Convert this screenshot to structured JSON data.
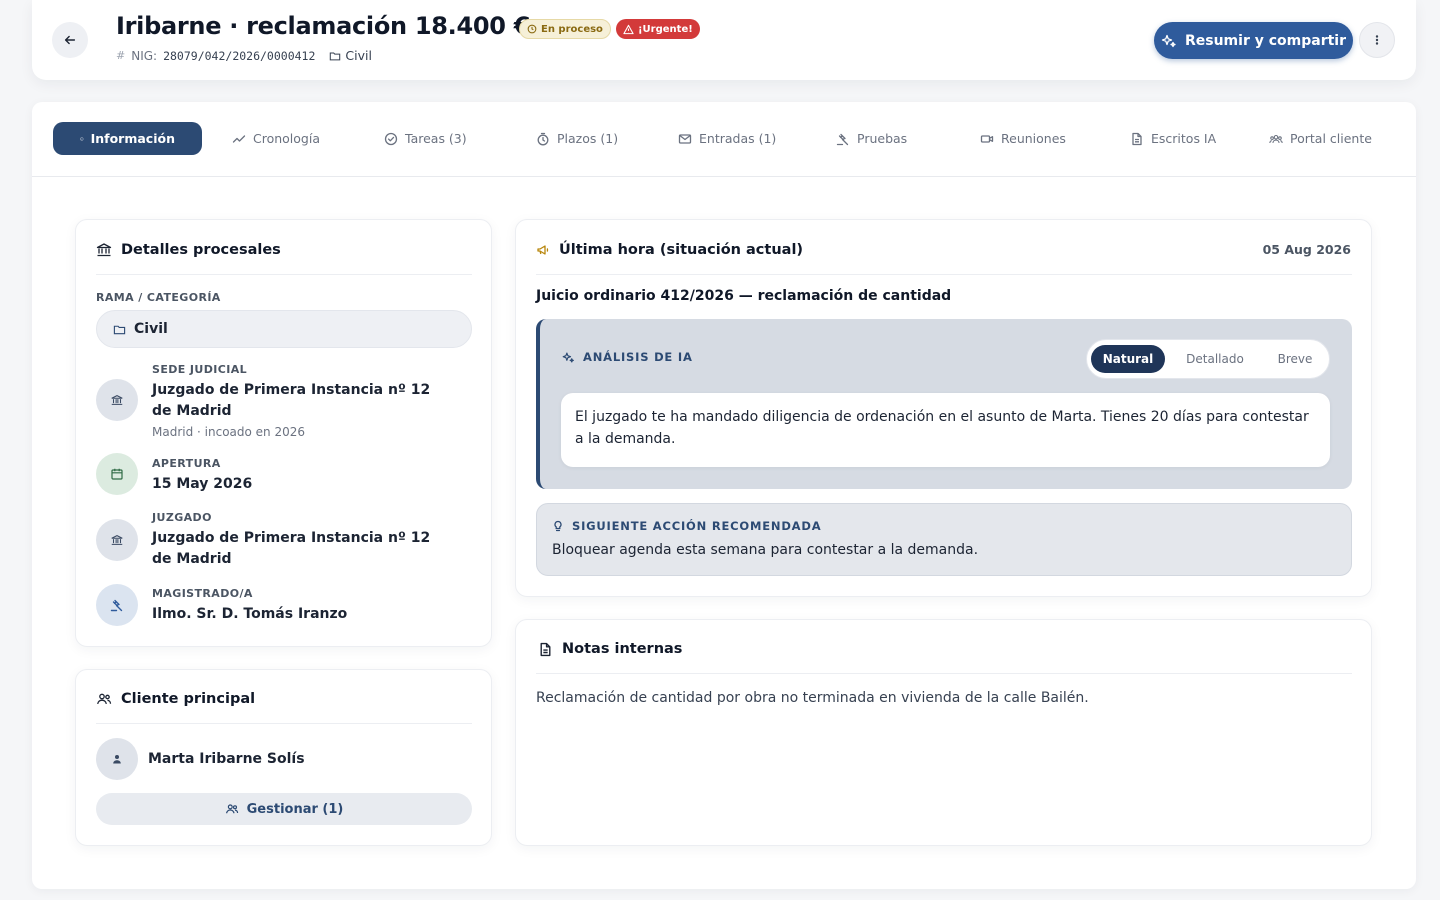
{
  "header": {
    "title": "Iribarne · reclamación 18.400 €",
    "status_badge": "En proceso",
    "urgent_badge": "¡Urgente!",
    "nig_label": "NIG:",
    "nig_value": "28079/042/2026/0000412",
    "category": "Civil",
    "primary_action": "Resumir y compartir"
  },
  "tabs": [
    {
      "label": "Información",
      "icon": "info-icon"
    },
    {
      "label": "Cronología",
      "icon": "trend-icon"
    },
    {
      "label": "Tareas (3)",
      "icon": "check-circle-icon"
    },
    {
      "label": "Plazos (1)",
      "icon": "timer-icon"
    },
    {
      "label": "Entradas (1)",
      "icon": "mail-icon"
    },
    {
      "label": "Pruebas",
      "icon": "gavel-icon"
    },
    {
      "label": "Reuniones",
      "icon": "video-icon"
    },
    {
      "label": "Escritos IA",
      "icon": "document-icon"
    },
    {
      "label": "Portal cliente",
      "icon": "group-icon"
    }
  ],
  "details": {
    "title": "Detalles procesales",
    "category_label": "RAMA / CATEGORÍA",
    "category_value": "Civil",
    "items": [
      {
        "key": "SEDE JUDICIAL",
        "value": "Juzgado de Primera Instancia nº 12 de Madrid",
        "sub": "Madrid · incoado en 2026"
      },
      {
        "key": "APERTURA",
        "value": "15 May 2026"
      },
      {
        "key": "JUZGADO",
        "value": "Juzgado de Primera Instancia nº 12 de Madrid"
      },
      {
        "key": "MAGISTRADO/A",
        "value": "Ilmo. Sr. D. Tomás Iranzo"
      }
    ]
  },
  "client": {
    "title": "Cliente principal",
    "name": "Marta Iribarne Solís",
    "manage": "Gestionar (1)"
  },
  "latest": {
    "title": "Última hora (situación actual)",
    "date": "05 Aug 2026",
    "subtitle": "Juicio ordinario 412/2026 — reclamación de cantidad",
    "ai_label": "ANÁLISIS DE IA",
    "modes": [
      "Natural",
      "Detallado",
      "Breve"
    ],
    "ai_text": "El juzgado te ha mandado diligencia de ordenación en el asunto de Marta. Tienes 20 días para contestar a la demanda.",
    "next_label": "SIGUIENTE ACCIÓN RECOMENDADA",
    "next_text": "Bloquear agenda esta semana para contestar a la demanda."
  },
  "notes": {
    "title": "Notas internas",
    "text": "Reclamación de cantidad por obra no terminada en vivienda de la calle Bailén."
  },
  "colors": {
    "accent": "#2f5b9c",
    "dark": "#2c4a73",
    "urgent": "#d33a3a"
  }
}
